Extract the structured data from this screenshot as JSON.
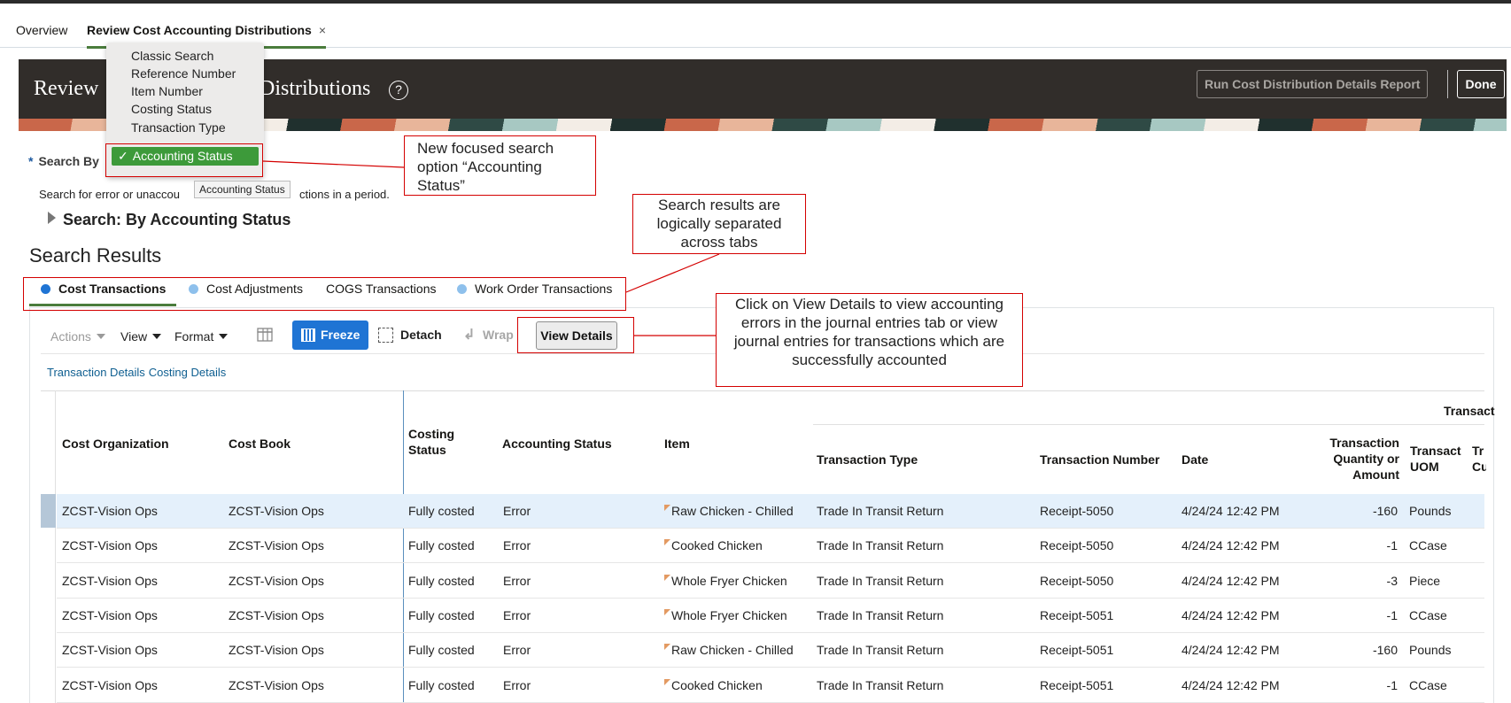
{
  "page_tabs": {
    "overview": "Overview",
    "active": "Review Cost Accounting Distributions",
    "close": "×"
  },
  "header": {
    "title_left": "Review",
    "title_right": "Distributions",
    "help": "?",
    "run_report": "Run Cost Distribution Details Report",
    "done": "Done"
  },
  "search": {
    "required_mark": "*",
    "label": "Search By",
    "desc_start": "Search for error or unaccou",
    "desc_end": "ctions in a period.",
    "section_title": "Search: By Accounting Status",
    "tooltip": "Accounting Status"
  },
  "dropdown": {
    "items": [
      "Classic Search",
      "Reference Number",
      "Item Number",
      "Costing Status",
      "Transaction Type"
    ],
    "selected": "Accounting Status",
    "check": "✓"
  },
  "results_title": "Search Results",
  "sub_tabs": [
    {
      "label": "Cost Transactions",
      "dot_color": "#1f74d4"
    },
    {
      "label": "Cost Adjustments",
      "dot_color": "#8ec0ec"
    },
    {
      "label": "COGS Transactions",
      "dot_color": ""
    },
    {
      "label": "Work Order Transactions",
      "dot_color": "#8ec0ec"
    }
  ],
  "toolbar": {
    "actions": "Actions",
    "view": "View",
    "format": "Format",
    "freeze": "Freeze",
    "detach": "Detach",
    "wrap": "Wrap",
    "view_details": "View Details",
    "columns_icon": "columns-icon"
  },
  "tx_links": [
    "Transaction Details",
    "Costing Details"
  ],
  "table": {
    "group_header": "Transact",
    "headers": {
      "cost_org": "Cost Organization",
      "cost_book": "Cost Book",
      "costing_status": "Costing Status",
      "accounting_status": "Accounting Status",
      "item": "Item",
      "transaction_type": "Transaction Type",
      "transaction_number": "Transaction Number",
      "date": "Date",
      "quantity": "Transaction Quantity or Amount",
      "uom": "Transact UOM",
      "cut": "Tr Cu"
    },
    "rows": [
      {
        "cost_org": "ZCST-Vision Ops",
        "cost_book": "ZCST-Vision Ops",
        "costing_status": "Fully costed",
        "accounting_status": "Error",
        "item": "Raw Chicken - Chilled",
        "transaction_type": "Trade In Transit Return",
        "transaction_number": "Receipt-5050",
        "date": "4/24/24 12:42 PM",
        "quantity": "-160",
        "uom": "Pounds"
      },
      {
        "cost_org": "ZCST-Vision Ops",
        "cost_book": "ZCST-Vision Ops",
        "costing_status": "Fully costed",
        "accounting_status": "Error",
        "item": "Cooked Chicken",
        "transaction_type": "Trade In Transit Return",
        "transaction_number": "Receipt-5050",
        "date": "4/24/24 12:42 PM",
        "quantity": "-1",
        "uom": "CCase"
      },
      {
        "cost_org": "ZCST-Vision Ops",
        "cost_book": "ZCST-Vision Ops",
        "costing_status": "Fully costed",
        "accounting_status": "Error",
        "item": "Whole Fryer Chicken",
        "transaction_type": "Trade In Transit Return",
        "transaction_number": "Receipt-5050",
        "date": "4/24/24 12:42 PM",
        "quantity": "-3",
        "uom": "Piece"
      },
      {
        "cost_org": "ZCST-Vision Ops",
        "cost_book": "ZCST-Vision Ops",
        "costing_status": "Fully costed",
        "accounting_status": "Error",
        "item": "Whole Fryer Chicken",
        "transaction_type": "Trade In Transit Return",
        "transaction_number": "Receipt-5051",
        "date": "4/24/24 12:42 PM",
        "quantity": "-1",
        "uom": "CCase"
      },
      {
        "cost_org": "ZCST-Vision Ops",
        "cost_book": "ZCST-Vision Ops",
        "costing_status": "Fully costed",
        "accounting_status": "Error",
        "item": "Raw Chicken - Chilled",
        "transaction_type": "Trade In Transit Return",
        "transaction_number": "Receipt-5051",
        "date": "4/24/24 12:42 PM",
        "quantity": "-160",
        "uom": "Pounds"
      },
      {
        "cost_org": "ZCST-Vision Ops",
        "cost_book": "ZCST-Vision Ops",
        "costing_status": "Fully costed",
        "accounting_status": "Error",
        "item": "Cooked Chicken",
        "transaction_type": "Trade In Transit Return",
        "transaction_number": "Receipt-5051",
        "date": "4/24/24 12:42 PM",
        "quantity": "-1",
        "uom": "CCase"
      }
    ]
  },
  "callouts": {
    "search_option": "New focused search option “Accounting Status”",
    "tabs": "Search results are logically separated across tabs",
    "view_details": "Click on View Details to view accounting errors in the journal entries tab or view journal entries for transactions which are successfully accounted"
  },
  "colors": {
    "callout_red": "#d40000",
    "primary_blue": "#1f74d4",
    "selected_green": "#3d9a3a",
    "header_dark": "#312d2a"
  }
}
